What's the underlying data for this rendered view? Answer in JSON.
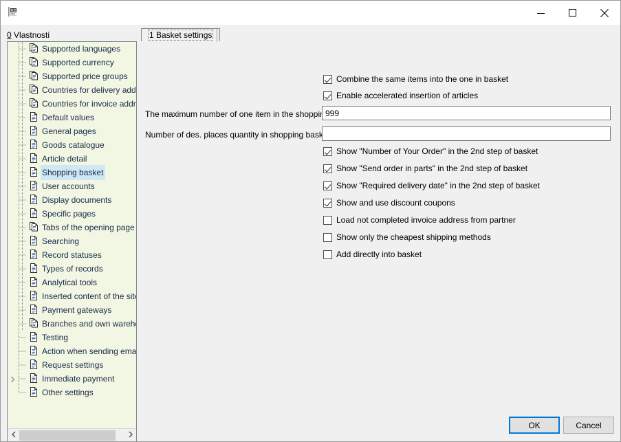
{
  "window": {
    "title": "",
    "icon": "k2-logo-icon",
    "controls": {
      "minimize": "minimize-icon",
      "maximize": "maximize-icon",
      "close": "close-icon"
    }
  },
  "left_panel": {
    "label_accel": "0",
    "label_text": " Vlastnosti",
    "tree_items": [
      {
        "label": "Supported languages",
        "icon": "double-document-icon",
        "selected": false,
        "expandable": false
      },
      {
        "label": "Supported currency",
        "icon": "double-document-icon",
        "selected": false,
        "expandable": false
      },
      {
        "label": "Supported price groups",
        "icon": "double-document-icon",
        "selected": false,
        "expandable": false
      },
      {
        "label": "Countries for delivery addresses",
        "icon": "double-document-icon",
        "selected": false,
        "expandable": false
      },
      {
        "label": "Countries for invoice addresses",
        "icon": "double-document-icon",
        "selected": false,
        "expandable": false
      },
      {
        "label": "Default values",
        "icon": "document-icon",
        "selected": false,
        "expandable": false
      },
      {
        "label": "General pages",
        "icon": "document-icon",
        "selected": false,
        "expandable": false
      },
      {
        "label": "Goods catalogue",
        "icon": "document-icon",
        "selected": false,
        "expandable": false
      },
      {
        "label": "Article detail",
        "icon": "document-icon",
        "selected": false,
        "expandable": false
      },
      {
        "label": "Shopping basket",
        "icon": "document-icon",
        "selected": true,
        "expandable": false
      },
      {
        "label": "User accounts",
        "icon": "document-icon",
        "selected": false,
        "expandable": false
      },
      {
        "label": "Display documents",
        "icon": "document-icon",
        "selected": false,
        "expandable": false
      },
      {
        "label": "Specific pages",
        "icon": "document-icon",
        "selected": false,
        "expandable": false
      },
      {
        "label": "Tabs of the opening page",
        "icon": "double-document-icon",
        "selected": false,
        "expandable": false
      },
      {
        "label": "Searching",
        "icon": "document-icon",
        "selected": false,
        "expandable": false
      },
      {
        "label": "Record statuses",
        "icon": "document-icon",
        "selected": false,
        "expandable": false
      },
      {
        "label": "Types of records",
        "icon": "document-icon",
        "selected": false,
        "expandable": false
      },
      {
        "label": "Analytical tools",
        "icon": "document-icon",
        "selected": false,
        "expandable": false
      },
      {
        "label": "Inserted content of the sites",
        "icon": "document-icon",
        "selected": false,
        "expandable": false
      },
      {
        "label": "Payment gateways",
        "icon": "document-icon",
        "selected": false,
        "expandable": false
      },
      {
        "label": "Branches and own warehouses",
        "icon": "double-document-icon",
        "selected": false,
        "expandable": false
      },
      {
        "label": "Testing",
        "icon": "document-icon",
        "selected": false,
        "expandable": false
      },
      {
        "label": "Action when sending email",
        "icon": "document-icon",
        "selected": false,
        "expandable": false
      },
      {
        "label": "Request settings",
        "icon": "document-icon",
        "selected": false,
        "expandable": false
      },
      {
        "label": "Immediate payment",
        "icon": "document-icon",
        "selected": false,
        "expandable": true
      },
      {
        "label": "Other settings",
        "icon": "document-icon",
        "selected": false,
        "expandable": false
      }
    ],
    "scrollbar": {
      "left_arrow": "chevron-left-icon",
      "right_arrow": "chevron-right-icon"
    }
  },
  "tabs": [
    {
      "label": "1 Basket settings",
      "active": true
    }
  ],
  "form": {
    "checkbox_top": [
      {
        "label": "Combine the same items into the one in basket",
        "checked": true
      },
      {
        "label": "Enable accelerated insertion of articles",
        "checked": true
      }
    ],
    "fields": [
      {
        "label": "The maximum number of one item in the shopping...",
        "value": "999",
        "placeholder": ""
      },
      {
        "label": "Number of des. places quantity in shopping basket",
        "value": "",
        "placeholder": ""
      }
    ],
    "checkbox_bottom": [
      {
        "label": "Show \"Number of Your Order\" in the 2nd step of basket",
        "checked": true
      },
      {
        "label": "Show \"Send order in parts\" in the 2nd step of basket",
        "checked": true
      },
      {
        "label": "Show \"Required delivery date\" in the 2nd step of basket",
        "checked": true
      },
      {
        "label": "Show and use discount coupons",
        "checked": true
      },
      {
        "label": "Load not completed invoice address from partner",
        "checked": false
      },
      {
        "label": "Show only the cheapest shipping methods",
        "checked": false
      },
      {
        "label": "Add directly into basket",
        "checked": false
      }
    ]
  },
  "footer": {
    "ok_label": "OK",
    "cancel_label": "Cancel"
  },
  "colors": {
    "tree_background": "#f1f7e2",
    "tree_text": "#1a2a4a",
    "selection": "#cfe8f3",
    "accent": "#0078d7",
    "window_background": "#f0f0f0"
  }
}
